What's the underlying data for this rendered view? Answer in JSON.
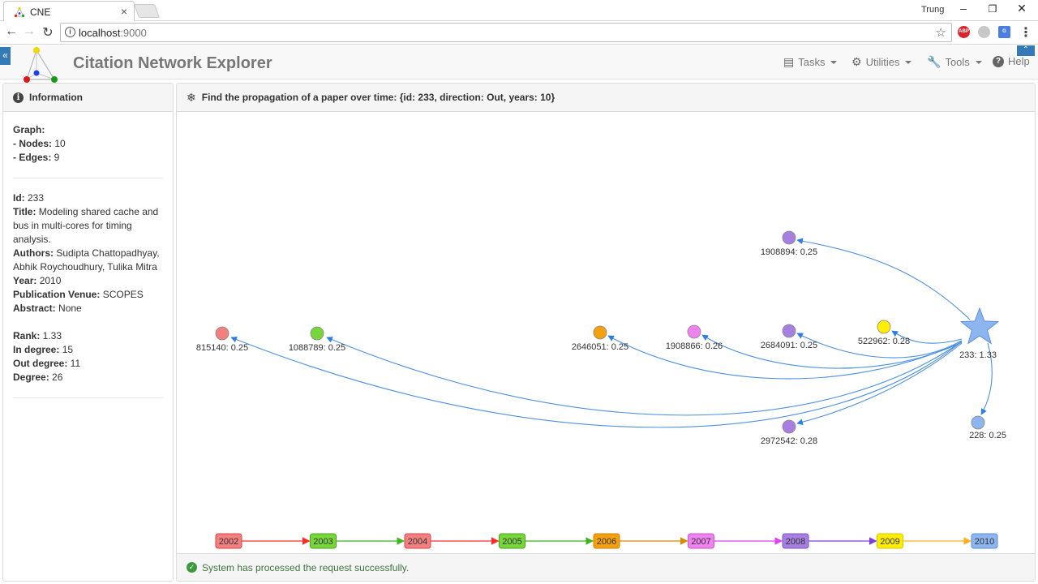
{
  "browser": {
    "tab_title": "CNE",
    "tab_close": "×",
    "window_user": "Trung",
    "url_host": "localhost",
    "url_port": ":9000",
    "window_controls": [
      "–",
      "❐",
      "✕"
    ]
  },
  "app": {
    "title": "Citation Network Explorer",
    "menu": {
      "tasks": "Tasks",
      "utilities": "Utilities",
      "tools": "Tools",
      "help": "Help"
    }
  },
  "info_panel": {
    "header": "Information",
    "graph_label": "Graph:",
    "nodes_label": "- Nodes:",
    "nodes_value": " 10",
    "edges_label": "- Edges:",
    "edges_value": " 9",
    "id_label": "Id:",
    "id_value": " 233",
    "title_label": "Title:",
    "title_value": " Modeling shared cache and bus in multi-cores for timing analysis.",
    "authors_label": "Authors:",
    "authors_value": " Sudipta Chattopadhyay, Abhik Roychoudhury, Tulika Mitra",
    "year_label": "Year:",
    "year_value": " 2010",
    "venue_label": "Publication Venue:",
    "venue_value": " SCOPES",
    "abstract_label": "Abstract:",
    "abstract_value": " None",
    "rank_label": "Rank:",
    "rank_value": " 1.33",
    "indegree_label": "In degree:",
    "indegree_value": " 15",
    "outdegree_label": "Out degree:",
    "outdegree_value": " 11",
    "degree_label": "Degree:",
    "degree_value": " 26"
  },
  "graph_panel": {
    "header": "Find the propagation of a paper over time: {id: 233, direction: Out, years: 10}",
    "status": "System has processed the request successfully."
  },
  "graph": {
    "source": {
      "label": "233: 1.33",
      "color": "#8db5f0"
    },
    "nodes": [
      {
        "id": "815140",
        "label": "815140: 0.25",
        "color": "#f28080",
        "year": "2002"
      },
      {
        "id": "1088789",
        "label": "1088789: 0.25",
        "color": "#77d63a",
        "year": "2003"
      },
      {
        "id": "2646051",
        "label": "2646051: 0.25",
        "color": "#f5a00e",
        "year": "2006"
      },
      {
        "id": "1908866",
        "label": "1908866: 0.26",
        "color": "#ee82ee",
        "year": "2007"
      },
      {
        "id": "2684091",
        "label": "2684091: 0.25",
        "color": "#a67fe0",
        "year": "2008"
      },
      {
        "id": "1908894",
        "label": "1908894: 0.25",
        "color": "#a67fe0",
        "year": "2008"
      },
      {
        "id": "2972542",
        "label": "2972542: 0.28",
        "color": "#a67fe0",
        "year": "2008"
      },
      {
        "id": "522962",
        "label": "522962: 0.28",
        "color": "#ffee00",
        "year": "2009"
      },
      {
        "id": "228",
        "label": "228: 0.25",
        "color": "#8db5f0",
        "year": "2010"
      }
    ],
    "timeline": [
      {
        "year": "2002",
        "fill": "#f28080",
        "stroke": "#e04040",
        "arrow": "#ff2a2a"
      },
      {
        "year": "2003",
        "fill": "#77d63a",
        "stroke": "#4aa41a",
        "arrow": "#3fb51f"
      },
      {
        "year": "2004",
        "fill": "#f28080",
        "stroke": "#e04040",
        "arrow": "#ff2a2a"
      },
      {
        "year": "2005",
        "fill": "#77d63a",
        "stroke": "#4aa41a",
        "arrow": "#3fb51f"
      },
      {
        "year": "2006",
        "fill": "#f5a00e",
        "stroke": "#d08000",
        "arrow": "#d98a00"
      },
      {
        "year": "2007",
        "fill": "#ee82ee",
        "stroke": "#d050d0",
        "arrow": "#e040f0"
      },
      {
        "year": "2008",
        "fill": "#a67fe0",
        "stroke": "#7f55c8",
        "arrow": "#7e3ce0"
      },
      {
        "year": "2009",
        "fill": "#ffee00",
        "stroke": "#d8c400",
        "arrow": "#ffb020"
      },
      {
        "year": "2010",
        "fill": "#8db5f0",
        "stroke": "#5a8fd8",
        "arrow": null
      }
    ]
  }
}
